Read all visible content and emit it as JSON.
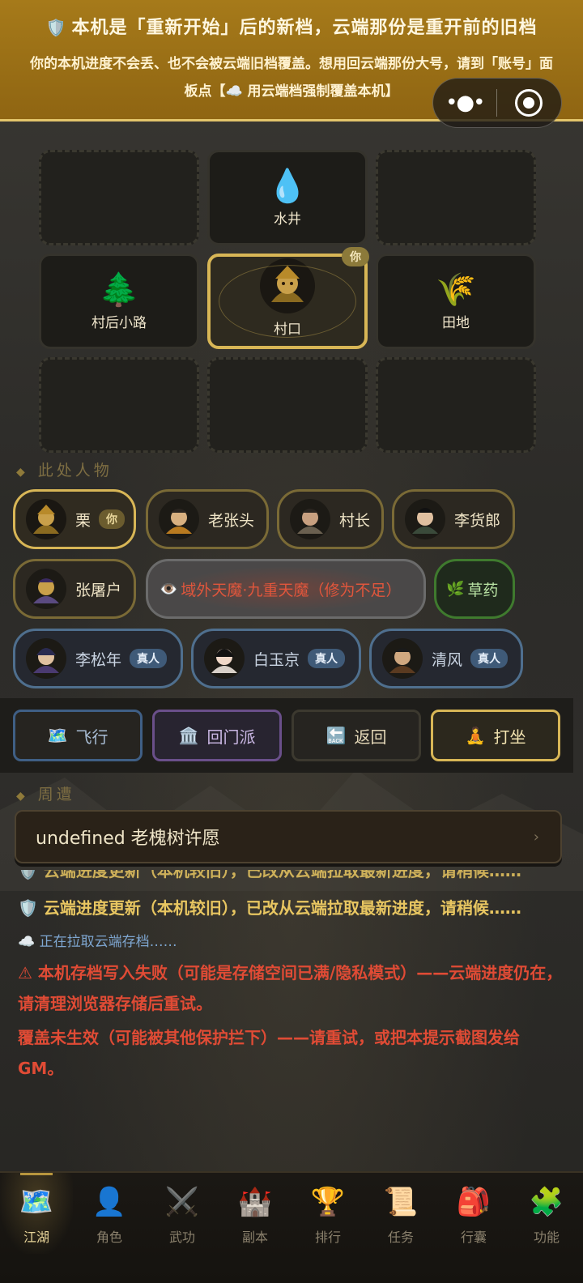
{
  "banner": {
    "title": "本机是「重新开始」后的新档，云端那份是重开前的旧档",
    "body": "你的本机进度不会丢、也不会被云端旧档覆盖。想用回云端那份大号，请到「账号」面板点【☁️ 用云端档强制覆盖本机】"
  },
  "capsule": {
    "more_icon": "more-dots-icon",
    "close_icon": "record-target-icon"
  },
  "map": {
    "cells": [
      {
        "label": "",
        "emoji": ""
      },
      {
        "label": "水井",
        "emoji": "💧"
      },
      {
        "label": "",
        "emoji": ""
      },
      {
        "label": "村后小路",
        "emoji": "🌲"
      },
      {
        "label": "村口",
        "emoji": "",
        "current": true,
        "tag": "你"
      },
      {
        "label": "田地",
        "emoji": "🌾"
      },
      {
        "label": "",
        "emoji": ""
      },
      {
        "label": "",
        "emoji": ""
      },
      {
        "label": "",
        "emoji": ""
      }
    ]
  },
  "people": {
    "header": "此处人物",
    "chips": [
      {
        "name": "栗",
        "badge": "你",
        "kind": "self"
      },
      {
        "name": "老张头"
      },
      {
        "name": "村长"
      },
      {
        "name": "李货郎"
      },
      {
        "name": "张屠户"
      },
      {
        "name": "域外天魔·九重天魔（修为不足）",
        "kind": "demon",
        "icon": "👁️"
      },
      {
        "name": "草药",
        "kind": "herb",
        "icon": "🌿"
      },
      {
        "name": "李松年",
        "badge": "真人",
        "kind": "real"
      },
      {
        "name": "白玉京",
        "badge": "真人",
        "kind": "real"
      },
      {
        "name": "清风",
        "badge": "真人",
        "kind": "real"
      }
    ]
  },
  "actions": {
    "fly": {
      "label": "飞行",
      "icon": "🗺️"
    },
    "sect": {
      "label": "回门派",
      "icon": "🏛️"
    },
    "back": {
      "label": "返回",
      "icon": "🔙"
    },
    "meditate": {
      "label": "打坐",
      "icon": "🧘"
    }
  },
  "surroundings": {
    "header": "周遭",
    "item": "undefined 老槐树许愿",
    "chevron": "›"
  },
  "log": [
    {
      "text": "🛡️ 云端进度更新（本机较旧），已改从云端拉取最新进度，请稍候……",
      "style": "yellow"
    },
    {
      "text": "🛡️ 云端进度更新（本机较旧），已改从云端拉取最新进度，请稍候……",
      "style": "yellow"
    },
    {
      "text": "☁️ 正在拉取云端存档……",
      "style": "blue"
    },
    {
      "text": "⚠ 本机存档写入失败（可能是存储空间已满/隐私模式）——云端进度仍在，请清理浏览器存储后重试。",
      "style": "red"
    },
    {
      "text": "覆盖未生效（可能被其他保护拦下）——请重试，或把本提示截图发给 GM。",
      "style": "red"
    }
  ],
  "nav": [
    {
      "label": "江湖",
      "icon": "🗺️",
      "active": true
    },
    {
      "label": "角色",
      "icon": "👤"
    },
    {
      "label": "武功",
      "icon": "⚔️",
      "dim": true
    },
    {
      "label": "副本",
      "icon": "🏰"
    },
    {
      "label": "排行",
      "icon": "🏆"
    },
    {
      "label": "任务",
      "icon": "📜"
    },
    {
      "label": "行囊",
      "icon": "🎒"
    },
    {
      "label": "功能",
      "icon": "🧩"
    }
  ],
  "colors": {
    "banner": "#a67a1a",
    "gold_border": "#d8b656",
    "real_border": "#4f6f8e",
    "herb_border": "#3f7a2e",
    "sect_border": "#6a4f8a",
    "warn_red": "#e04b35",
    "notice_yellow": "#e8c661"
  }
}
